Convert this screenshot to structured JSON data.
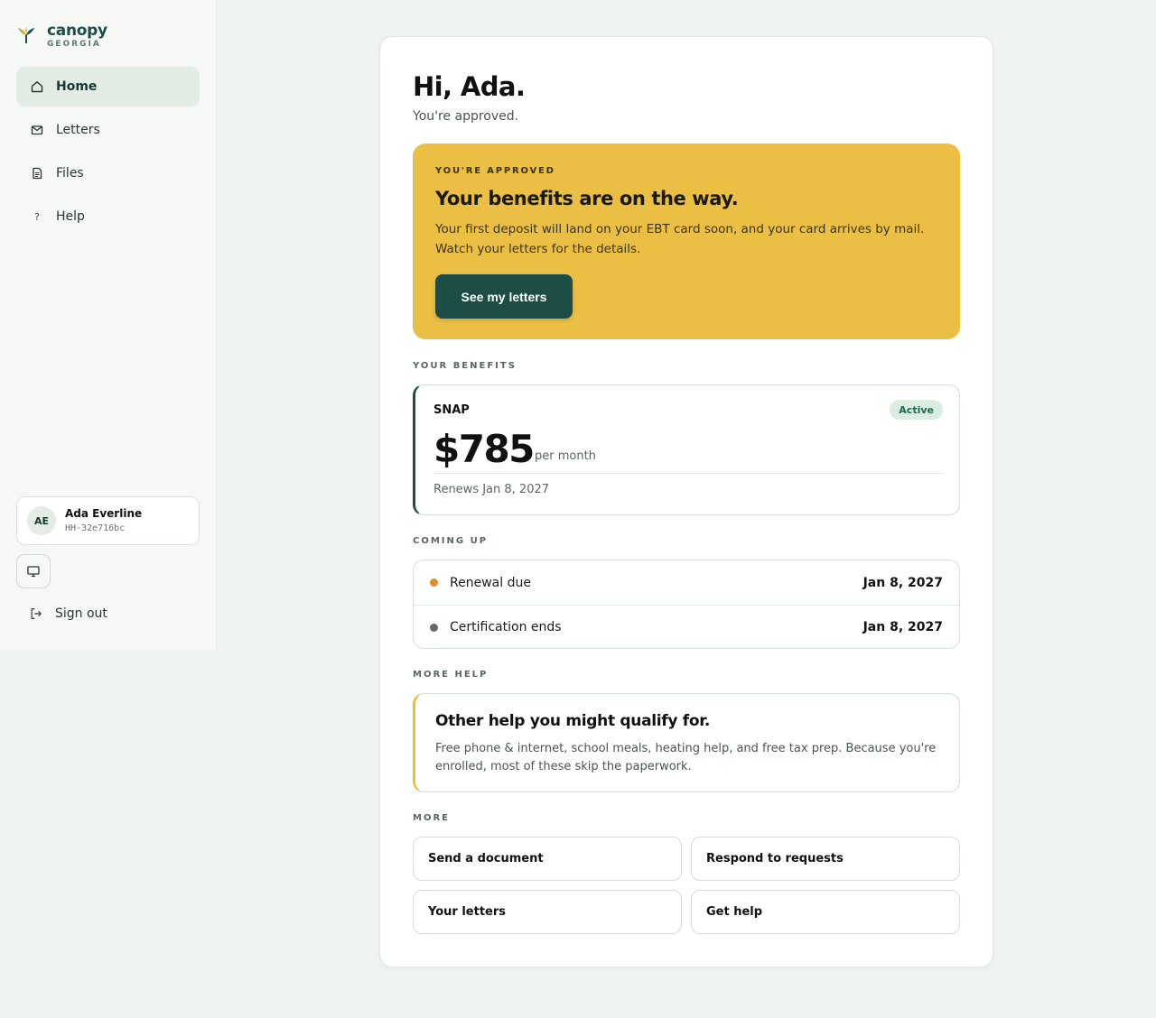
{
  "brand": {
    "name": "canopy",
    "sub": "GEORGIA"
  },
  "nav": {
    "items": [
      {
        "label": "Home",
        "icon": "home-icon"
      },
      {
        "label": "Letters",
        "icon": "mail-icon"
      },
      {
        "label": "Files",
        "icon": "file-icon"
      },
      {
        "label": "Help",
        "icon": "question-icon"
      }
    ],
    "active": "Home",
    "signout": "Sign out"
  },
  "user": {
    "initials": "AE",
    "name": "Ada Everline",
    "id": "HH-32e716bc"
  },
  "greeting": {
    "title": "Hi, Ada.",
    "subtitle": "You're approved."
  },
  "hero": {
    "kicker": "YOU'RE APPROVED",
    "title": "Your benefits are on the way.",
    "body": "Your first deposit will land on your EBT card soon, and your card arrives by mail. Watch your letters for the details.",
    "button": "See my letters"
  },
  "benefits": {
    "label": "YOUR BENEFITS",
    "name": "SNAP",
    "status": "Active",
    "amount": "$785",
    "period": "per month",
    "renews": "Renews Jan 8, 2027"
  },
  "coming_up": {
    "label": "COMING UP",
    "items": [
      {
        "label": "Renewal due",
        "date": "Jan 8, 2027",
        "color": "#e08a2e"
      },
      {
        "label": "Certification ends",
        "date": "Jan 8, 2027",
        "color": "#5f6b66"
      }
    ]
  },
  "more_help": {
    "label": "MORE HELP",
    "title": "Other help you might qualify for.",
    "body": "Free phone & internet, school meals, heating help, and free tax prep. Because you're enrolled, most of these skip the paperwork."
  },
  "more": {
    "label": "MORE",
    "links": [
      "Send a document",
      "Respond to requests",
      "Your letters",
      "Get help"
    ]
  },
  "colors": {
    "accent": "#1e4d45",
    "hero": "#ebbe44",
    "background": "#f0f4f0"
  }
}
